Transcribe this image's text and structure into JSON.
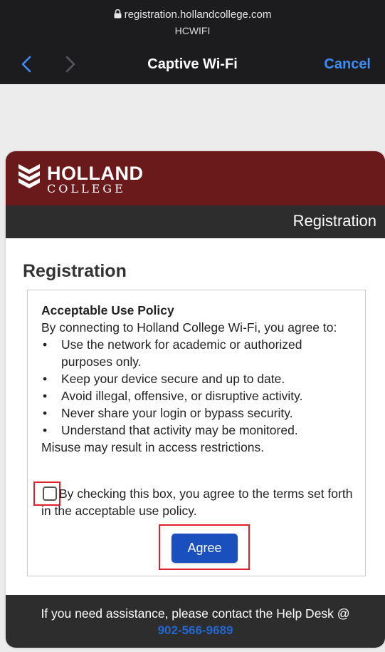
{
  "browser": {
    "url": "registration.hollandcollege.com",
    "ssid": "HCWIFI",
    "title": "Captive Wi-Fi",
    "cancel_label": "Cancel"
  },
  "brand": {
    "name_line1": "HOLLAND",
    "name_line2": "COLLEGE",
    "color": "#6b1a1c"
  },
  "section_bar": {
    "label": "Registration"
  },
  "page_title": "Registration",
  "policy": {
    "heading": "Acceptable Use Policy",
    "intro": "By connecting to Holland College Wi-Fi, you agree to:",
    "bullets": [
      "Use the network for academic or authorized purposes only.",
      "Keep your device secure and up to date.",
      "Avoid illegal, offensive, or disruptive activity.",
      "Never share your login or bypass security.",
      "Understand that activity may be monitored."
    ],
    "closing": "Misuse may result in access restrictions."
  },
  "consent": {
    "text": "By checking this box, you agree to the terms set forth in the acceptable use policy.",
    "checked": false
  },
  "agree_label": "Agree",
  "footer": {
    "text": "If you need assistance, please contact the Help Desk @",
    "phone": "902-566-9689"
  },
  "colors": {
    "accent_blue": "#1a4fbe",
    "link_blue": "#2367d1",
    "highlight_red": "#e0212b",
    "ios_blue": "#3d8ef7"
  }
}
